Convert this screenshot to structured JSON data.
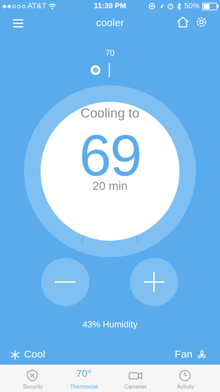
{
  "status_bar": {
    "carrier": "AT&T",
    "time": "11:39 PM",
    "battery": "50%",
    "battery_level": 0.5
  },
  "header": {
    "title": "cooler",
    "menu_icon": "hamburger-menu-icon",
    "home_icon": "home-icon",
    "settings_icon": "gear-icon"
  },
  "thermostat": {
    "setpoint": "70",
    "status": "Cooling to",
    "current_temp": "69",
    "eta": "20 min",
    "humidity": "43% Humidity"
  },
  "controls": {
    "mode": "Cool",
    "fan": "Fan"
  },
  "tabs": [
    {
      "label": "Security",
      "icon": "shield-icon"
    },
    {
      "label": "Thermostat",
      "value": "70°",
      "icon": "thermostat-icon"
    },
    {
      "label": "Cameras",
      "icon": "camera-icon"
    },
    {
      "label": "Activity",
      "icon": "clock-icon"
    }
  ],
  "colors": {
    "background": "#5aabec",
    "dial_ring": "#7fbff1",
    "tab_active": "#5aabec",
    "tab_inactive": "#9a9a9a"
  }
}
